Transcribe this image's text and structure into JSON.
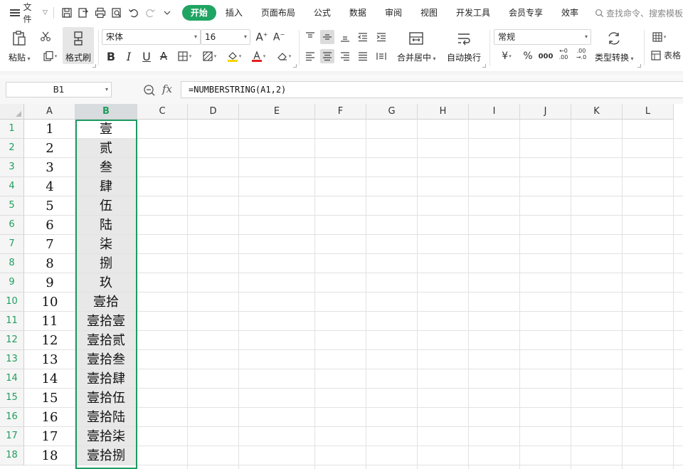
{
  "menubar": {
    "file_label": "文件",
    "tabs": [
      {
        "label": "开始",
        "active": true
      },
      {
        "label": "插入"
      },
      {
        "label": "页面布局"
      },
      {
        "label": "公式"
      },
      {
        "label": "数据"
      },
      {
        "label": "审阅"
      },
      {
        "label": "视图"
      },
      {
        "label": "开发工具"
      },
      {
        "label": "会员专享"
      },
      {
        "label": "效率"
      }
    ],
    "search_placeholder": "查找命令、搜索模板"
  },
  "ribbon": {
    "paste_label": "粘贴",
    "format_painter_label": "格式刷",
    "font_name": "宋体",
    "font_size": "16",
    "merge_center_label": "合并居中",
    "wrap_text_label": "自动换行",
    "number_format": "常规",
    "type_convert_label": "类型转换",
    "table_style_label": "表格",
    "currency_symbol": "¥",
    "percent_symbol": "%",
    "thousands_symbol": "000",
    "inc_decimal": "←0 .00",
    "dec_decimal": ".00 →.0",
    "font_color": "#e02020",
    "fill_color": "#f5d400"
  },
  "formula_bar": {
    "name_box": "B1",
    "fx_label": "fx",
    "formula": "=NUMBERSTRING(A1,2)"
  },
  "sheet": {
    "columns": [
      "A",
      "B",
      "C",
      "D",
      "E",
      "F",
      "G",
      "H",
      "I",
      "J",
      "K",
      "L"
    ],
    "selected_column": "B",
    "accent_color": "#1fa463",
    "rows": [
      {
        "n": "1",
        "a": "1",
        "b": "壹"
      },
      {
        "n": "2",
        "a": "2",
        "b": "贰"
      },
      {
        "n": "3",
        "a": "3",
        "b": "叁"
      },
      {
        "n": "4",
        "a": "4",
        "b": "肆"
      },
      {
        "n": "5",
        "a": "5",
        "b": "伍"
      },
      {
        "n": "6",
        "a": "6",
        "b": "陆"
      },
      {
        "n": "7",
        "a": "7",
        "b": "柒"
      },
      {
        "n": "8",
        "a": "8",
        "b": "捌"
      },
      {
        "n": "9",
        "a": "9",
        "b": "玖"
      },
      {
        "n": "10",
        "a": "10",
        "b": "壹拾"
      },
      {
        "n": "11",
        "a": "11",
        "b": "壹拾壹"
      },
      {
        "n": "12",
        "a": "12",
        "b": "壹拾贰"
      },
      {
        "n": "13",
        "a": "13",
        "b": "壹拾叁"
      },
      {
        "n": "14",
        "a": "14",
        "b": "壹拾肆"
      },
      {
        "n": "15",
        "a": "15",
        "b": "壹拾伍"
      },
      {
        "n": "16",
        "a": "16",
        "b": "壹拾陆"
      },
      {
        "n": "17",
        "a": "17",
        "b": "壹拾柒"
      },
      {
        "n": "18",
        "a": "18",
        "b": "壹拾捌"
      }
    ]
  }
}
